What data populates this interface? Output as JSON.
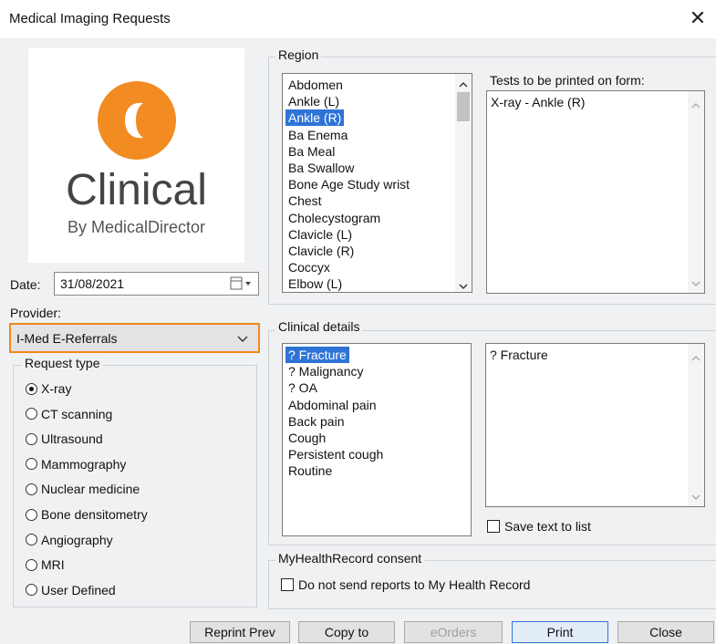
{
  "window": {
    "title": "Medical Imaging Requests"
  },
  "logo": {
    "name": "Clinical",
    "sub": "By MedicalDirector",
    "accent": "#f28b22"
  },
  "date": {
    "label": "Date:",
    "value": "31/08/2021"
  },
  "provider": {
    "label": "Provider:",
    "value": "I-Med E-Referrals",
    "highlight": "#f08a1c"
  },
  "request_type": {
    "title": "Request type",
    "selected": "X-ray",
    "options": [
      "X-ray",
      "CT scanning",
      "Ultrasound",
      "Mammography",
      "Nuclear medicine",
      "Bone densitometry",
      "Angiography",
      "MRI",
      "User Defined"
    ]
  },
  "region": {
    "title": "Region",
    "selected": "Ankle (R)",
    "items": [
      "Abdomen",
      "Ankle (L)",
      "Ankle (R)",
      "Ba Enema",
      "Ba Meal",
      "Ba Swallow",
      "Bone Age Study wrist",
      "Chest",
      "Cholecystogram",
      "Clavicle (L)",
      "Clavicle (R)",
      "Coccyx",
      "Elbow (L)"
    ]
  },
  "tests": {
    "label": "Tests to be printed on form:",
    "value": "X-ray - Ankle (R)"
  },
  "clinical": {
    "title": "Clinical details",
    "selected": "? Fracture",
    "items": [
      "? Fracture",
      "? Malignancy",
      "? OA",
      "Abdominal pain",
      "Back pain",
      "Cough",
      "Persistent cough",
      "Routine"
    ],
    "text": "? Fracture",
    "save_label": "Save text to list"
  },
  "myhealth": {
    "title": "MyHealthRecord consent",
    "checkbox_label": "Do not send reports to My Health Record"
  },
  "buttons": {
    "reprint": "Reprint Prev",
    "copy": "Copy to",
    "eorders": "eOrders",
    "print": "Print",
    "close": "Close"
  },
  "colors": {
    "selection": "#2e74d6"
  }
}
